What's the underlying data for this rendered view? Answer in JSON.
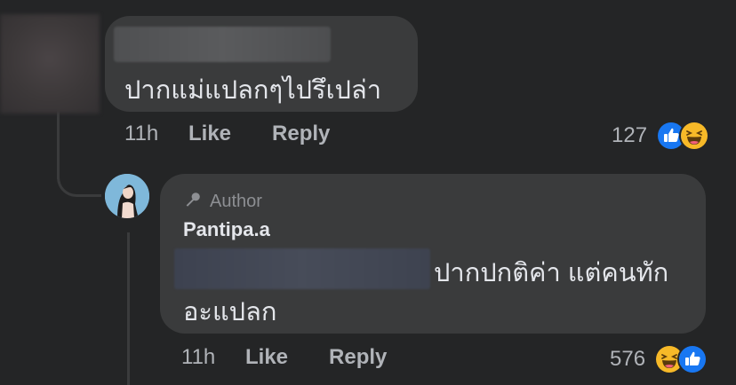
{
  "comment1": {
    "text": "ปากแม่แปลกๆไปรึเปล่า",
    "time": "11h",
    "like_label": "Like",
    "reply_label": "Reply",
    "reaction_count": "127",
    "reactions": [
      "like-icon",
      "haha-icon"
    ]
  },
  "comment2": {
    "badge_label": "Author",
    "badge_icon": "microphone-icon",
    "author_name": "Pantipa.a",
    "text_line1": "ปากปกติค่า แต่คนทัก",
    "text_line2": "อะแปลก",
    "time": "11h",
    "like_label": "Like",
    "reply_label": "Reply",
    "reaction_count": "576",
    "reactions": [
      "haha-icon",
      "like-icon"
    ]
  },
  "colors": {
    "background": "#242526",
    "bubble": "#3a3b3c",
    "like_blue": "#1877f2",
    "haha_yellow": "#f7b928"
  }
}
